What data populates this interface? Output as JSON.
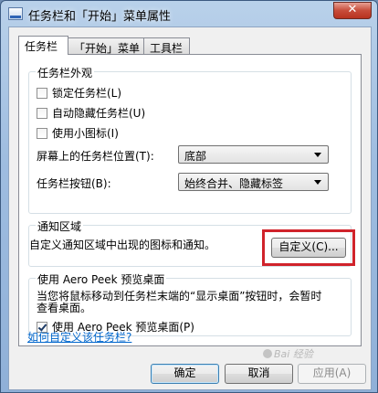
{
  "window": {
    "title": "任务栏和「开始」菜单属性",
    "close_label": "✕"
  },
  "tabs": [
    {
      "label": "任务栏",
      "active": true
    },
    {
      "label": "「开始」菜单",
      "active": false
    },
    {
      "label": "工具栏",
      "active": false
    }
  ],
  "appearance": {
    "title": "任务栏外观",
    "checkboxes": [
      {
        "label": "锁定任务栏(L)",
        "checked": false
      },
      {
        "label": "自动隐藏任务栏(U)",
        "checked": false
      },
      {
        "label": "使用小图标(I)",
        "checked": false
      }
    ],
    "position": {
      "label": "屏幕上的任务栏位置(T):",
      "value": "底部"
    },
    "buttons": {
      "label": "任务栏按钮(B):",
      "value": "始终合并、隐藏标签"
    }
  },
  "notification": {
    "title": "通知区域",
    "description": "自定义通知区域中出现的图标和通知。",
    "customize_label": "自定义(C)..."
  },
  "aero_peek": {
    "title": "使用 Aero Peek 预览桌面",
    "description_line1": "当您将鼠标移动到任务栏末端的“显示桌面”按钮时，会暂时",
    "description_line2": "查看桌面。",
    "checkbox_label": "使用 Aero Peek 预览桌面(P)",
    "checked": true
  },
  "help_link": "如何自定义该任务栏?",
  "footer": {
    "ok": "确定",
    "cancel": "取消",
    "apply": "应用(A)"
  },
  "watermark": "Bai 经验",
  "colors": {
    "highlight": "#d0232b",
    "link": "#0066cc"
  }
}
